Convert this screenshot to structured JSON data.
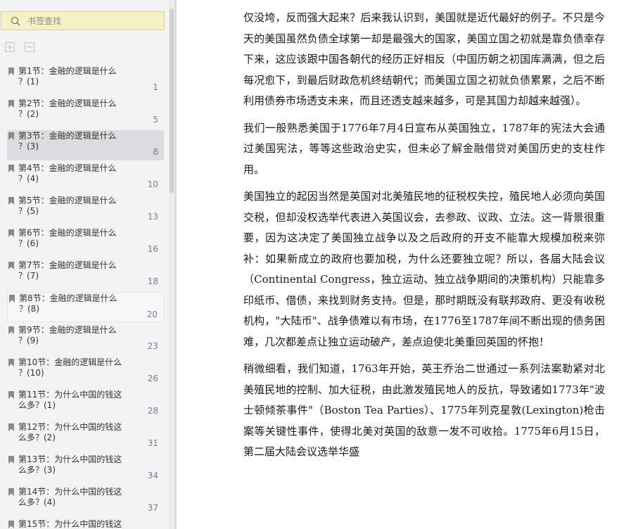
{
  "sidebar": {
    "search_placeholder": "书签查找",
    "icons": {
      "search": "search-icon",
      "expand": "expand-all-icon",
      "collapse": "collapse-all-icon",
      "bookmark": "bookmark-icon"
    },
    "selected_index": 2,
    "bookmarks": [
      {
        "title": "第1节：金融的逻辑是什么\n？(1)",
        "page": "1"
      },
      {
        "title": "第2节：金融的逻辑是什么\n？(2)",
        "page": "5"
      },
      {
        "title": "第3节：金融的逻辑是什么\n？(3)",
        "page": "8"
      },
      {
        "title": "第4节：金融的逻辑是什么\n？(4)",
        "page": "10"
      },
      {
        "title": "第5节：金融的逻辑是什么\n？(5)",
        "page": "13"
      },
      {
        "title": "第6节：金融的逻辑是什么\n？(6)",
        "page": "16"
      },
      {
        "title": "第7节：金融的逻辑是什么\n？(7)",
        "page": "18"
      },
      {
        "title": "第8节：金融的逻辑是什么\n？(8)",
        "page": "20"
      },
      {
        "title": "第9节：金融的逻辑是什么\n？(9)",
        "page": "23"
      },
      {
        "title": "第10节：金融的逻辑是什么\n？(10)",
        "page": "26"
      },
      {
        "title": "第11节：为什么中国的钱这\n么多？(1)",
        "page": "28"
      },
      {
        "title": "第12节：为什么中国的钱这\n么多？(2)",
        "page": "31"
      },
      {
        "title": "第13节：为什么中国的钱这\n么多？(3)",
        "page": "34"
      },
      {
        "title": "第14节：为什么中国的钱这\n么多？(4)",
        "page": "37"
      },
      {
        "title": "第15节：为什么中国的钱这",
        "page": ""
      }
    ]
  },
  "reader": {
    "paragraphs": [
      "仅没垮，反而强大起来？后来我认识到，美国就是近代最好的例子。不只是今天的美国虽然负债全球第一却是最强大的国家，美国立国之初就是靠负债幸存下来，这应该跟中国各朝代的经历正好相反（中国历朝之初国库满满，但之后每况愈下，到最后财政危机终结朝代；而美国立国之初就负债累累，之后不断利用债券市场透支未来，而且还透支越来越多，可是其国力却越来越强）。",
      "我们一般熟悉美国于1776年7月4日宣布从英国独立，1787年的宪法大会通过美国宪法，等等这些政治史实，但未必了解金融借贷对美国历史的支柱作用。",
      "美国独立的起因当然是英国对北美殖民地的征税权失控，殖民地人必须向英国交税，但却没权选举代表进入英国议会，去参政、议政、立法。这一背景很重要，因为这决定了美国独立战争以及之后政府的开支不能靠大规模加税来弥补：如果新成立的政府也要加税，为什么还要独立呢？所以，各届大陆会议（Continental Congress，独立运动、独立战争期间的决策机构）只能靠多印纸币、借债，来找到财务支持。但是，那时期既没有联邦政府、更没有收税机构，\"大陆币\"、战争债难以有市场，在1776至1787年间不断出现的债务困难，几次都差点让独立运动破产，差点迫使北美重回英国的怀抱！",
      "稍微细看，我们知道，1763年开始，英王乔治二世通过一系列法案勒紧对北美殖民地的控制、加大征税，由此激发殖民地人的反抗，导致诸如1773年\"波士顿倾茶事件\"（Boston Tea Parties）、1775年列克星敦(Lexington)枪击案等关键性事件，使得北美对英国的敌意一发不可收拾。1775年6月15日，第二届大陆会议选举华盛"
    ]
  }
}
